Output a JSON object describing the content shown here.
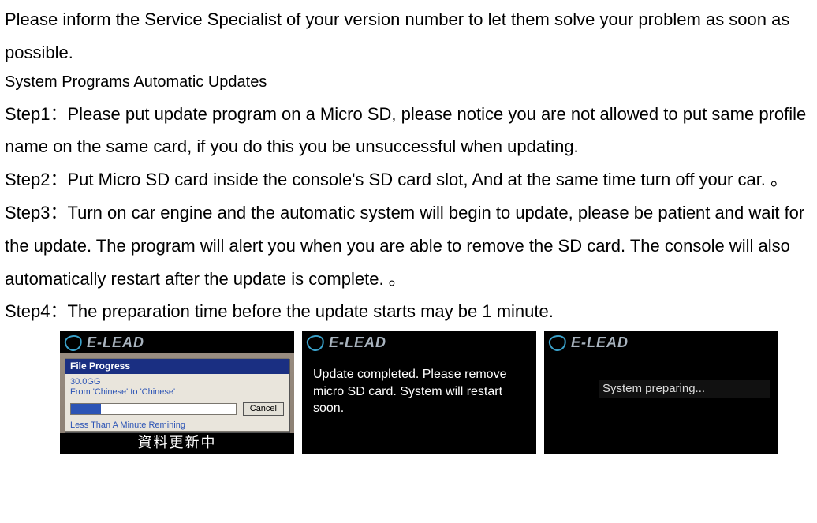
{
  "intro": "Please inform the Service Specialist of your version number to let them solve your problem as soon as possible.",
  "subheading": "System Programs Automatic Updates",
  "steps": {
    "s1": "Step1：Please put update program on a Micro SD, please notice you are not allowed to put same profile name on the same card, if you do this you be unsuccessful when updating.",
    "s2": "Step2：Put Micro SD card inside the console's SD card slot, And at the same time turn off your car. 。",
    "s3": "Step3：Turn on car engine and the automatic system will begin to update, please be patient and wait for the update.    The program will alert you when you are able to remove the SD card.  The console will also automatically restart after the update is complete.    。",
    "s4": "Step4：The preparation time before the update starts may be 1 minute."
  },
  "brand": "E-LEAD",
  "shot1": {
    "dialogTitle": "File Progress",
    "line1": "30.0GG",
    "line2": "From  'Chinese'  to  'Chinese'",
    "cancel": "Cancel",
    "remaining": "Less Than A Minute Remining",
    "footer": "資料更新中"
  },
  "shot2": {
    "message": "Update completed. Please remove micro SD card. System will restart soon."
  },
  "shot3": {
    "message": "System preparing..."
  }
}
